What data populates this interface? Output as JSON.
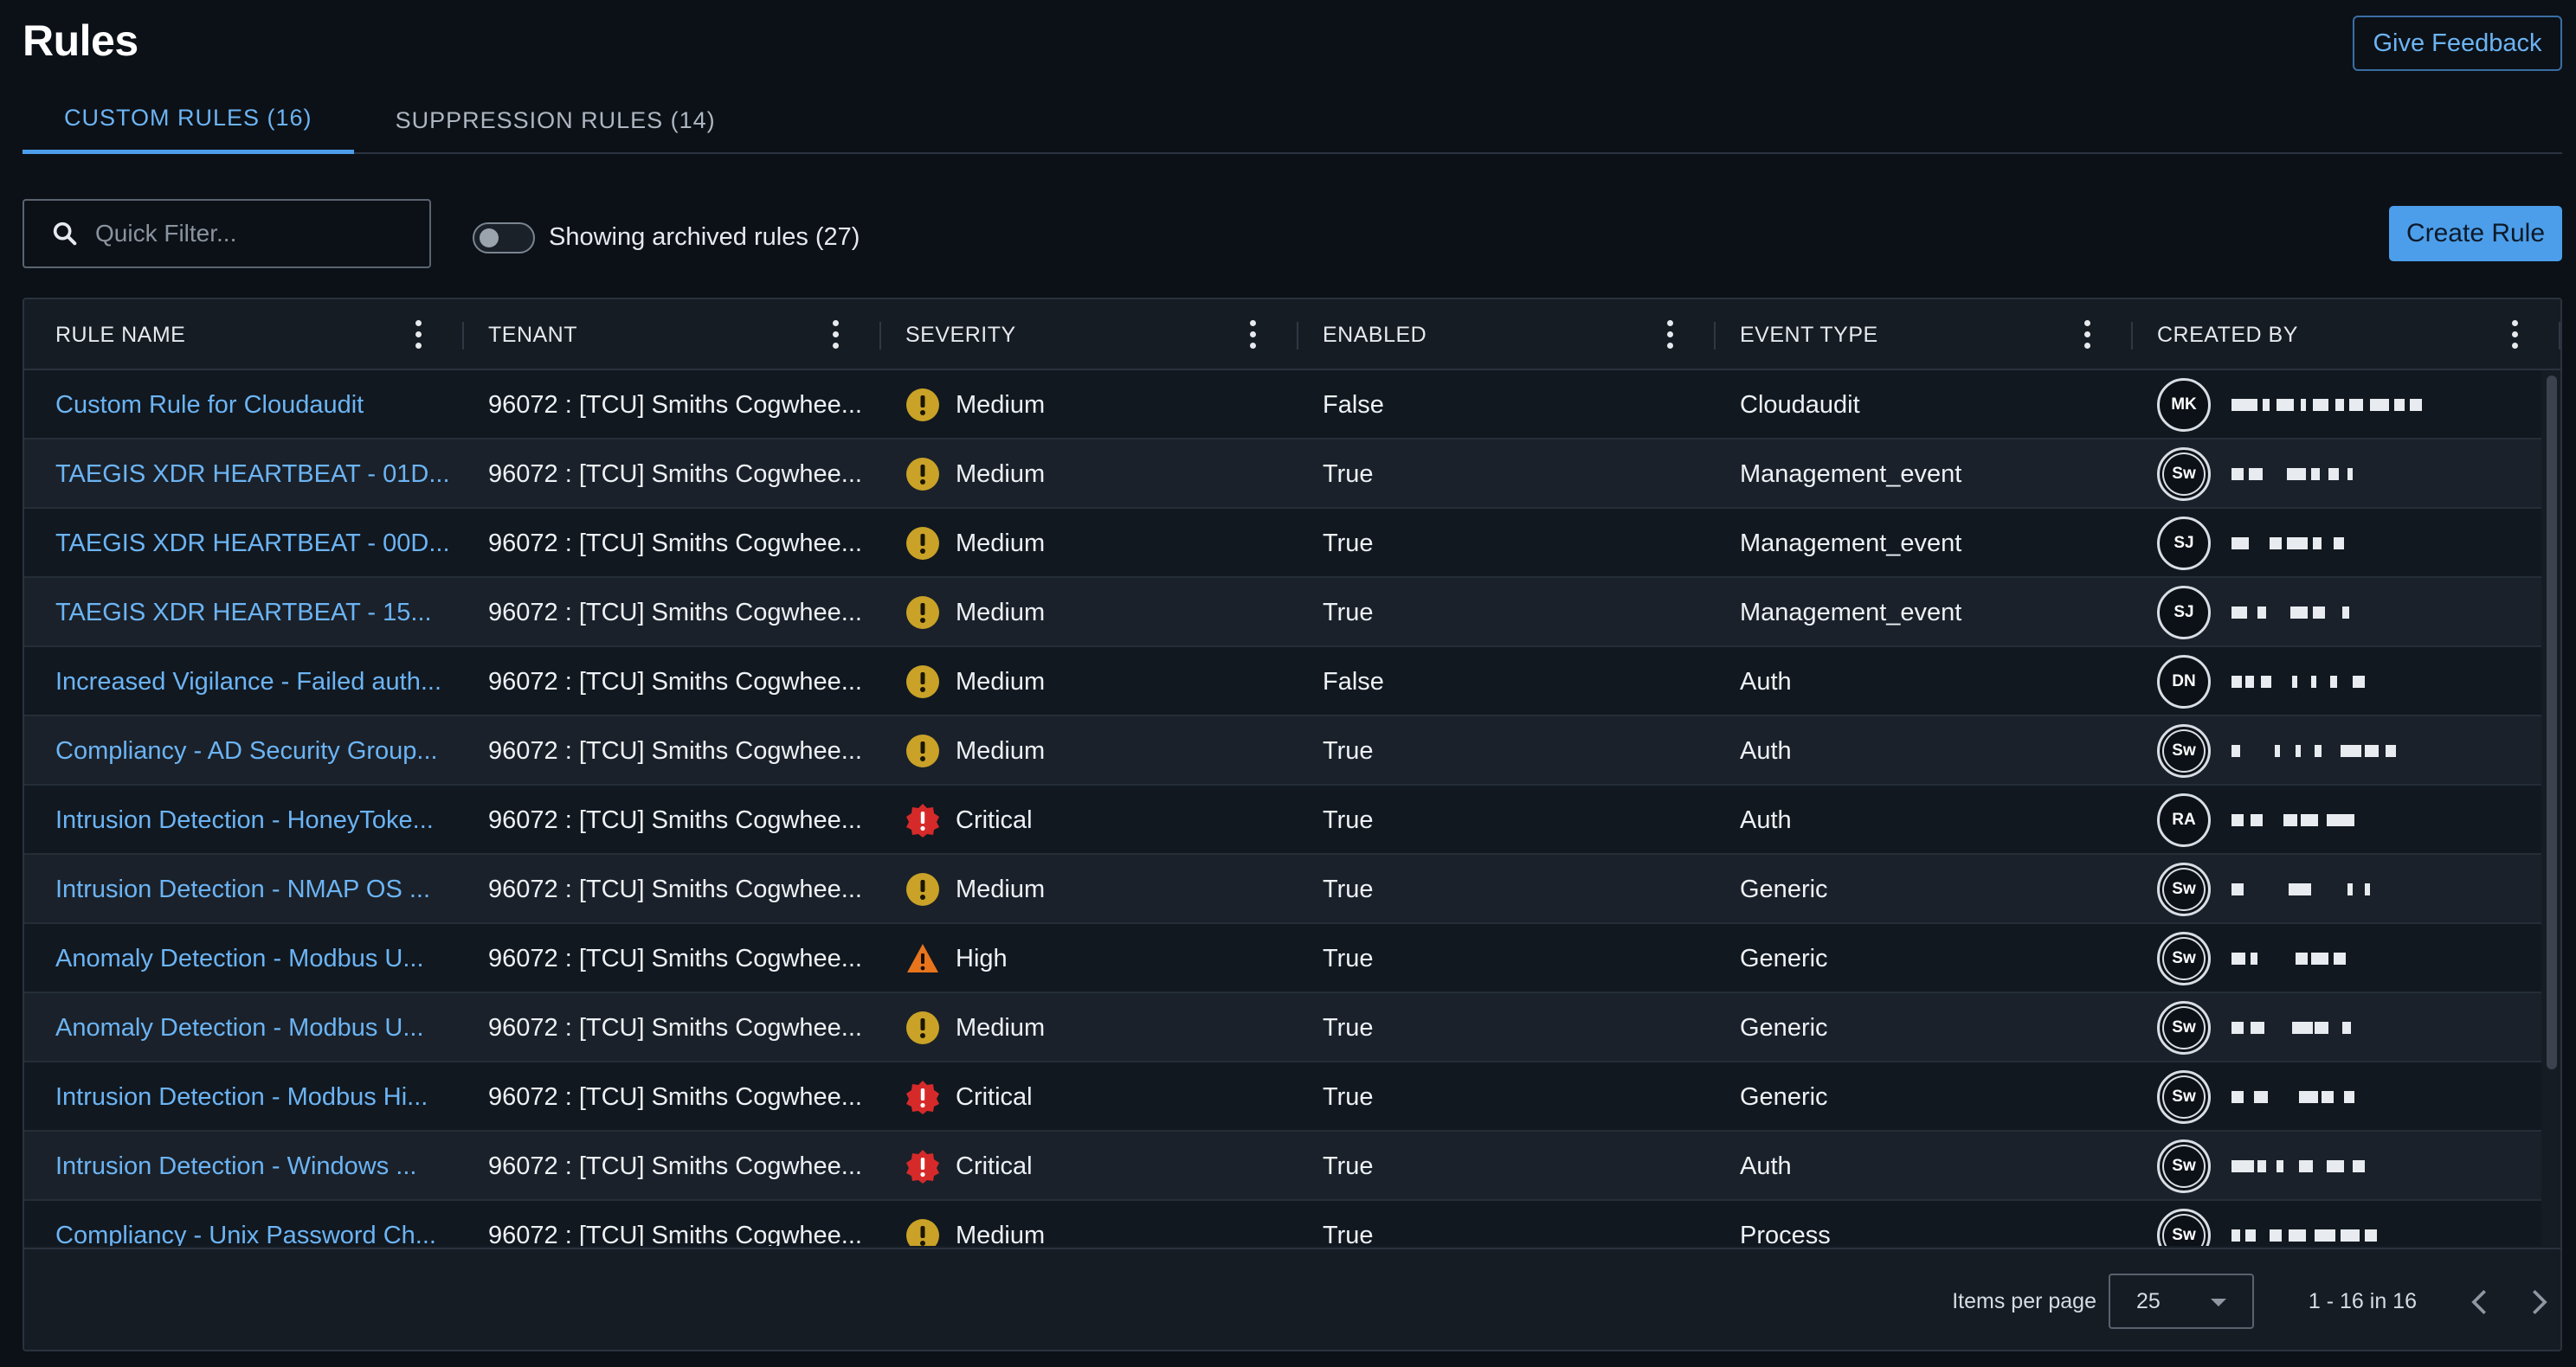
{
  "page": {
    "title": "Rules",
    "feedback_label": "Give Feedback",
    "create_label": "Create Rule"
  },
  "tabs": [
    {
      "label": "CUSTOM RULES (16)",
      "active": true
    },
    {
      "label": "SUPPRESSION RULES (14)",
      "active": false
    }
  ],
  "toolbar": {
    "search_placeholder": "Quick Filter...",
    "archived_toggle_on": false,
    "archived_label": "Showing archived rules (27)"
  },
  "table": {
    "columns": [
      "RULE NAME",
      "TENANT",
      "SEVERITY",
      "ENABLED",
      "EVENT TYPE",
      "CREATED BY"
    ],
    "rows": [
      {
        "name": "Custom Rule for Cloudaudit",
        "tenant": "96072 : [TCU] Smiths Cogwhee...",
        "severity": "Medium",
        "enabled": "False",
        "event_type": "Cloudaudit",
        "creator_initials": "MK"
      },
      {
        "name": "TAEGIS XDR HEARTBEAT - 01D...",
        "tenant": "96072 : [TCU] Smiths Cogwhee...",
        "severity": "Medium",
        "enabled": "True",
        "event_type": "Management_event",
        "creator_initials": "Sw"
      },
      {
        "name": "TAEGIS XDR HEARTBEAT - 00D...",
        "tenant": "96072 : [TCU] Smiths Cogwhee...",
        "severity": "Medium",
        "enabled": "True",
        "event_type": "Management_event",
        "creator_initials": "SJ"
      },
      {
        "name": "TAEGIS XDR HEARTBEAT - 15...",
        "tenant": "96072 : [TCU] Smiths Cogwhee...",
        "severity": "Medium",
        "enabled": "True",
        "event_type": "Management_event",
        "creator_initials": "SJ"
      },
      {
        "name": "Increased Vigilance - Failed auth...",
        "tenant": "96072 : [TCU] Smiths Cogwhee...",
        "severity": "Medium",
        "enabled": "False",
        "event_type": "Auth",
        "creator_initials": "DN"
      },
      {
        "name": "Compliancy - AD Security Group...",
        "tenant": "96072 : [TCU] Smiths Cogwhee...",
        "severity": "Medium",
        "enabled": "True",
        "event_type": "Auth",
        "creator_initials": "Sw"
      },
      {
        "name": "Intrusion Detection - HoneyToke...",
        "tenant": "96072 : [TCU] Smiths Cogwhee...",
        "severity": "Critical",
        "enabled": "True",
        "event_type": "Auth",
        "creator_initials": "RA"
      },
      {
        "name": "Intrusion Detection - NMAP OS ...",
        "tenant": "96072 : [TCU] Smiths Cogwhee...",
        "severity": "Medium",
        "enabled": "True",
        "event_type": "Generic",
        "creator_initials": "Sw"
      },
      {
        "name": "Anomaly Detection - Modbus U...",
        "tenant": "96072 : [TCU] Smiths Cogwhee...",
        "severity": "High",
        "enabled": "True",
        "event_type": "Generic",
        "creator_initials": "Sw"
      },
      {
        "name": "Anomaly Detection - Modbus U...",
        "tenant": "96072 : [TCU] Smiths Cogwhee...",
        "severity": "Medium",
        "enabled": "True",
        "event_type": "Generic",
        "creator_initials": "Sw"
      },
      {
        "name": "Intrusion Detection - Modbus Hi...",
        "tenant": "96072 : [TCU] Smiths Cogwhee...",
        "severity": "Critical",
        "enabled": "True",
        "event_type": "Generic",
        "creator_initials": "Sw"
      },
      {
        "name": "Intrusion Detection - Windows ...",
        "tenant": "96072 : [TCU] Smiths Cogwhee...",
        "severity": "Critical",
        "enabled": "True",
        "event_type": "Auth",
        "creator_initials": "Sw"
      },
      {
        "name": "Compliancy - Unix Password Ch...",
        "tenant": "96072 : [TCU] Smiths Cogwhee...",
        "severity": "Medium",
        "enabled": "True",
        "event_type": "Process",
        "creator_initials": "Sw"
      }
    ]
  },
  "pagination": {
    "items_per_page_label": "Items per page",
    "items_per_page": "25",
    "range_label": "1 - 16 in 16"
  },
  "colors": {
    "accent": "#4c9eea",
    "link": "#6cb4f4",
    "medium": "#c9a227",
    "high": "#e8741c",
    "critical": "#d62a2a"
  },
  "icons": {
    "search": "search-icon",
    "more": "more-vertical-icon",
    "medium": "medium-severity-icon",
    "high": "high-severity-warning-icon",
    "critical": "critical-severity-icon",
    "prev": "chevron-left-icon",
    "next": "chevron-right-icon"
  }
}
